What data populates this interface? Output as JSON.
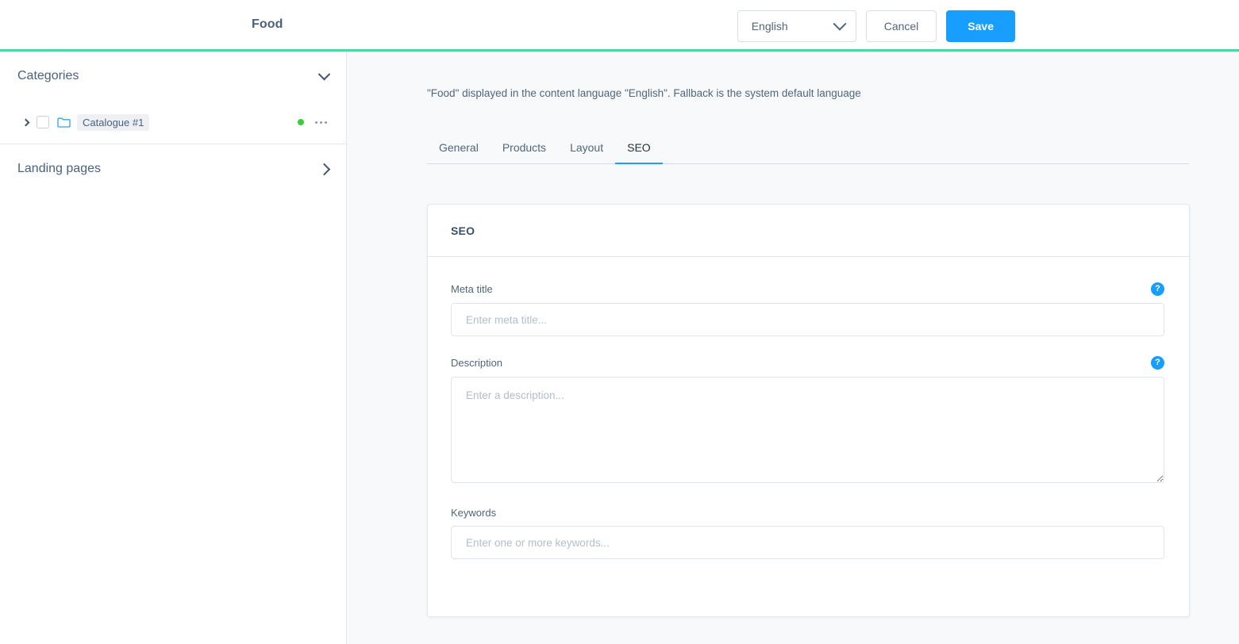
{
  "header": {
    "title": "Food",
    "language_value": "English",
    "cancel_label": "Cancel",
    "save_label": "Save",
    "accent_green": "#4DD79E",
    "accent_blue": "#189EFF"
  },
  "sidebar": {
    "categories": {
      "title": "Categories",
      "expanded": true,
      "chevron": "chevron-down-icon",
      "tree": [
        {
          "label": "Catalogue #1",
          "toggle": "chevron-right-icon",
          "checkbox_checked": false,
          "icon": "folder-icon",
          "status_color": "#37D039",
          "context_menu": "ellipsis-icon"
        }
      ]
    },
    "landing_pages": {
      "title": "Landing pages",
      "expanded": false,
      "chevron": "chevron-right-icon"
    }
  },
  "main": {
    "fallback_note": "\"Food\" displayed in the content language \"English\". Fallback is the system default language",
    "tabs": [
      {
        "label": "General",
        "active": false
      },
      {
        "label": "Products",
        "active": false
      },
      {
        "label": "Layout",
        "active": false
      },
      {
        "label": "SEO",
        "active": true
      }
    ],
    "card": {
      "title": "SEO",
      "fields": [
        {
          "label": "Meta title",
          "placeholder": "Enter meta title...",
          "value": "",
          "type": "input",
          "help": "?"
        },
        {
          "label": "Description",
          "placeholder": "Enter a description...",
          "value": "",
          "type": "textarea",
          "help": "?"
        },
        {
          "label": "Keywords",
          "placeholder": "Enter one or more keywords...",
          "value": "",
          "type": "input",
          "help": null
        }
      ]
    }
  }
}
